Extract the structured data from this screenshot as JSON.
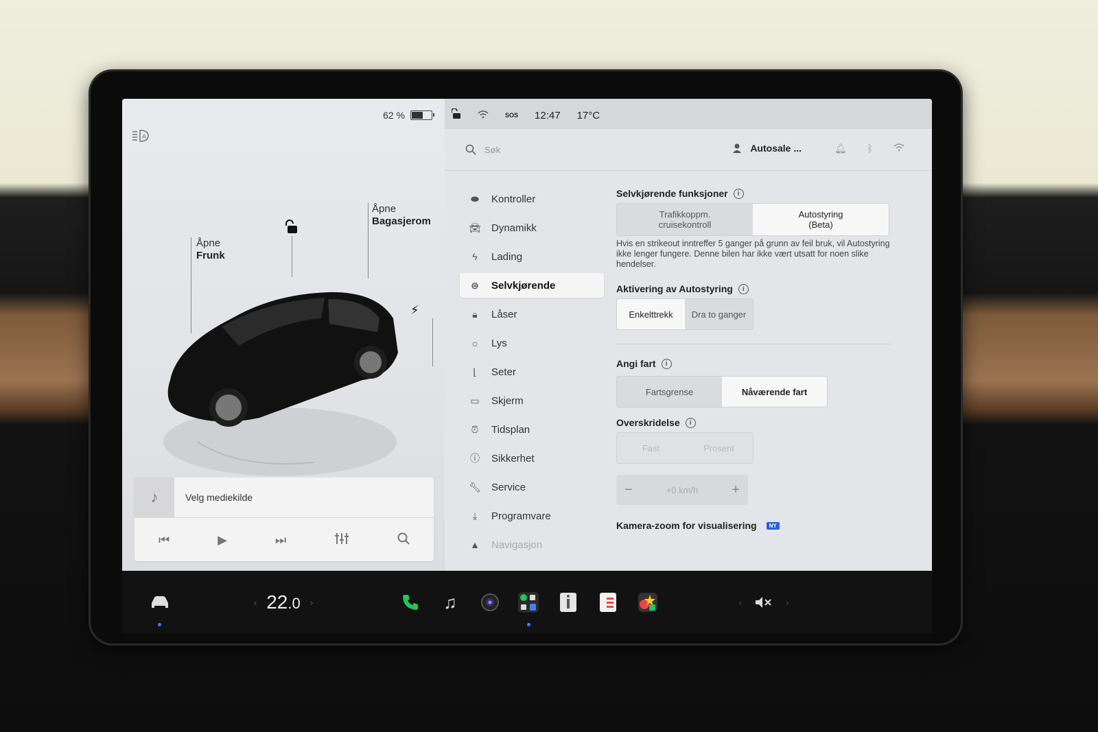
{
  "status_left": {
    "battery": "62 %",
    "battery_level": 0.62
  },
  "status_right": {
    "sos": "SOS",
    "time": "12:47",
    "temp": "17°C"
  },
  "car_labels": {
    "frunk_line1": "Åpne",
    "frunk_line2": "Frunk",
    "trunk_line1": "Åpne",
    "trunk_line2": "Bagasjerom"
  },
  "media": {
    "source": "Velg mediekilde"
  },
  "search": {
    "placeholder": "Søk"
  },
  "profile": {
    "name": "Autosale ..."
  },
  "menu": [
    {
      "label": "Kontroller",
      "icon": "toggle-icon"
    },
    {
      "label": "Dynamikk",
      "icon": "car-icon"
    },
    {
      "label": "Lading",
      "icon": "bolt-icon"
    },
    {
      "label": "Selvkjørende",
      "icon": "steering-wheel-icon",
      "active": true
    },
    {
      "label": "Låser",
      "icon": "lock-icon"
    },
    {
      "label": "Lys",
      "icon": "sun-icon"
    },
    {
      "label": "Seter",
      "icon": "seat-icon"
    },
    {
      "label": "Skjerm",
      "icon": "display-icon"
    },
    {
      "label": "Tidsplan",
      "icon": "alarm-icon"
    },
    {
      "label": "Sikkerhet",
      "icon": "alert-icon"
    },
    {
      "label": "Service",
      "icon": "wrench-icon"
    },
    {
      "label": "Programvare",
      "icon": "download-icon"
    },
    {
      "label": "Navigasjon",
      "icon": "navigation-icon"
    }
  ],
  "settings": {
    "self_driving_title": "Selvkjørende funksjoner",
    "option_tacc_line1": "Trafikkoppm.",
    "option_tacc_line2": "cruisekontroll",
    "option_autosteer_line1": "Autostyring",
    "option_autosteer_line2": "(Beta)",
    "strikeout_desc": "Hvis en strikeout inntreffer 5 ganger på grunn av feil bruk, vil Autostyring ikke lenger fungere. Denne bilen har ikke vært utsatt for noen slike hendelser.",
    "activation_title": "Aktivering av Autostyring",
    "activation_single": "Enkelttrekk",
    "activation_double": "Dra to ganger",
    "speed_title": "Angi fart",
    "speed_limit": "Fartsgrense",
    "speed_current": "Nåværende fart",
    "offset_title": "Overskridelse",
    "offset_fixed": "Fast",
    "offset_percent": "Prosent",
    "offset_value": "+0 km/h",
    "camera_zoom_title": "Kamera-zoom for visualisering",
    "new_badge": "NY"
  },
  "taskbar": {
    "temperature_main": "22",
    "temperature_decimal": ".0"
  }
}
